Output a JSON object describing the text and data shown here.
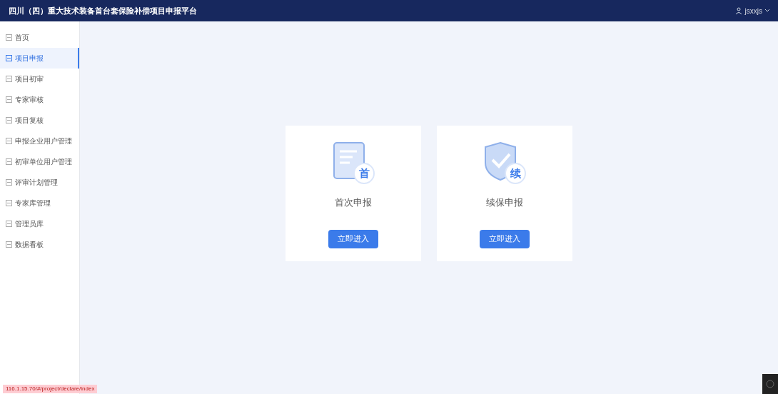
{
  "header": {
    "title": "四川（四）重大技术装备首台套保险补偿项目申报平台",
    "user": "jsxxjs"
  },
  "sidebar": {
    "items": [
      {
        "label": "首页",
        "selected": false
      },
      {
        "label": "项目申报",
        "selected": true
      },
      {
        "label": "项目初审",
        "selected": false
      },
      {
        "label": "专家审核",
        "selected": false
      },
      {
        "label": "项目复核",
        "selected": false
      },
      {
        "label": "申报企业用户管理",
        "selected": false
      },
      {
        "label": "初审单位用户管理",
        "selected": false
      },
      {
        "label": "评审计划管理",
        "selected": false
      },
      {
        "label": "专家库管理",
        "selected": false
      },
      {
        "label": "管理员库",
        "selected": false
      },
      {
        "label": "数据看板",
        "selected": false
      }
    ]
  },
  "cards": [
    {
      "kind": "first",
      "badge": "首",
      "title": "首次申报",
      "button": "立即进入"
    },
    {
      "kind": "renew",
      "badge": "续",
      "title": "续保申报",
      "button": "立即进入"
    }
  ],
  "status_url": "116.1.15.70/#/project/declare/index"
}
